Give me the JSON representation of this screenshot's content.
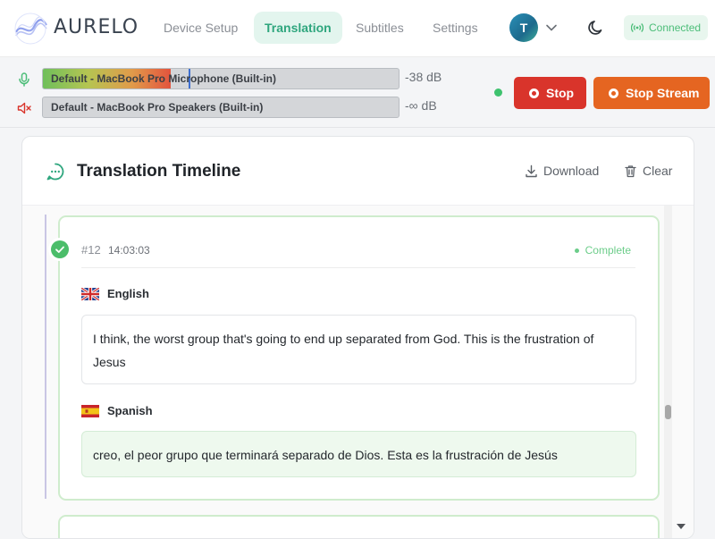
{
  "app": {
    "name": "AURELO"
  },
  "nav": {
    "tabs": [
      {
        "label": "Device Setup",
        "active": false
      },
      {
        "label": "Translation",
        "active": true
      },
      {
        "label": "Subtitles",
        "active": false
      },
      {
        "label": "Settings",
        "active": false
      }
    ]
  },
  "user": {
    "initial": "T"
  },
  "connection": {
    "status": "Connected",
    "color": "#4bbd78"
  },
  "audio": {
    "input": {
      "device": "Default - MacBook Pro Microphone (Built-in)",
      "level": "-38 dB",
      "fill_fraction": 0.36,
      "peak_fraction": 0.41
    },
    "output": {
      "device": "Default - MacBook Pro Speakers (Built-in)",
      "level": "-∞ dB",
      "muted": true
    }
  },
  "controls": {
    "stop_label": "Stop",
    "stop_stream_label": "Stop Stream"
  },
  "timeline": {
    "title": "Translation Timeline",
    "download_label": "Download",
    "clear_label": "Clear",
    "entries": [
      {
        "id": "#12",
        "time": "14:03:03",
        "status": "Complete",
        "source": {
          "language": "English",
          "text": "I think, the worst group that's going to end up separated from God. This is the frustration of Jesus"
        },
        "target": {
          "language": "Spanish",
          "text": "creo, el peor grupo que terminará separado de Dios. Esta es la frustración de Jesús"
        }
      }
    ]
  },
  "colors": {
    "accent": "#2fa67e",
    "stop": "#d9342b",
    "stop_stream": "#e56521",
    "complete": "#6ccd8a"
  },
  "icons": [
    "aurelo-logo",
    "chevron-down-icon",
    "moon-icon",
    "broadcast-icon",
    "microphone-icon",
    "speaker-muted-icon",
    "record-icon",
    "chat-bubble-icon",
    "download-icon",
    "trash-icon",
    "check-icon",
    "uk-flag-icon",
    "spain-flag-icon"
  ]
}
